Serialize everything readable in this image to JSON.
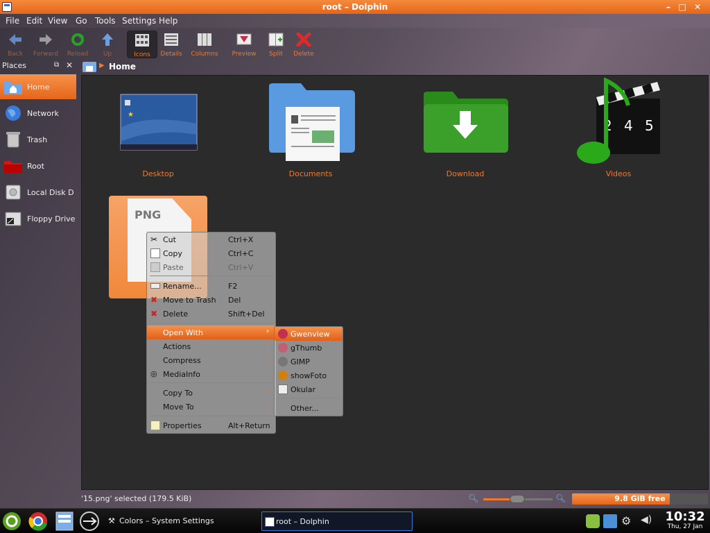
{
  "window": {
    "title": "root – Dolphin",
    "controls": [
      "–",
      "□",
      "✕"
    ]
  },
  "menubar": [
    "File",
    "Edit",
    "View",
    "Go",
    "Tools",
    "Settings",
    "Help"
  ],
  "toolbar": {
    "back": "Back",
    "forward": "Forward",
    "reload": "Reload",
    "up": "Up",
    "icons": "Icons",
    "details": "Details",
    "columns": "Columns",
    "preview": "Preview",
    "split": "Split",
    "delete": "Delete"
  },
  "places": {
    "title": "Places",
    "items": [
      "Home",
      "Network",
      "Trash",
      "Root",
      "Local Disk D",
      "Floppy Drive"
    ],
    "selected": "Home"
  },
  "breadcrumb": {
    "current": "Home"
  },
  "files": [
    "Desktop",
    "Documents",
    "Download",
    "Videos"
  ],
  "png_badge": "PNG",
  "context_menu": {
    "cut": {
      "label": "Cut",
      "shortcut": "Ctrl+X"
    },
    "copy": {
      "label": "Copy",
      "shortcut": "Ctrl+C"
    },
    "paste": {
      "label": "Paste",
      "shortcut": "Ctrl+V"
    },
    "rename": {
      "label": "Rename...",
      "shortcut": "F2"
    },
    "trash": {
      "label": "Move to Trash",
      "shortcut": "Del"
    },
    "delete": {
      "label": "Delete",
      "shortcut": "Shift+Del"
    },
    "open_with": "Open With",
    "actions": "Actions",
    "compress": "Compress",
    "mediainfo": "MediaInfo",
    "copy_to": "Copy To",
    "move_to": "Move To",
    "properties": {
      "label": "Properties",
      "shortcut": "Alt+Return"
    }
  },
  "open_with": [
    "Gwenview",
    "gThumb",
    "GIMP",
    "showFoto",
    "Okular",
    "Other..."
  ],
  "statusbar": {
    "text": "'15.png' selected (179.5 KiB)",
    "free": "9.8 GiB free",
    "free_fraction": 0.72,
    "zoom_fraction": 0.4
  },
  "taskbar": {
    "tasks": [
      "Colors – System Settings",
      "root – Dolphin"
    ],
    "time": "10:32",
    "date": "Thu, 27 Jan"
  },
  "colors": {
    "accent": "#e5661a",
    "folder_blue": "#5a9ae0",
    "folder_green": "#3a9a2a"
  }
}
